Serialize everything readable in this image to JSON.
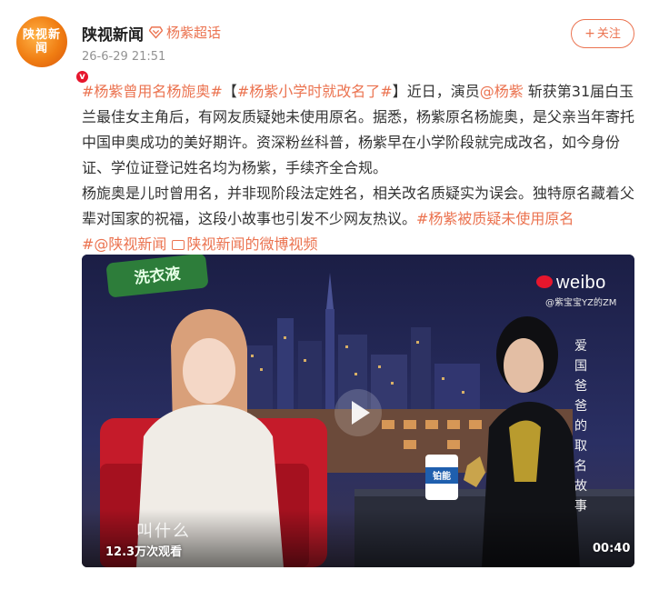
{
  "post": {
    "author": "陕视新闻",
    "avatar_text": "陕视新闻",
    "super_topic": "杨紫超话",
    "time": "26-6-29 21:51",
    "follow_label": "关注",
    "follow_plus": "+"
  },
  "content": {
    "tag1": "#杨紫曾用名杨旎奥#",
    "bracket_open": "【",
    "tag2": "#杨紫小学时就改名了#",
    "bracket_close": "】",
    "t1": "近日，演员",
    "mention": "@杨紫",
    "t2": " 斩获第31届白玉兰最佳女主角后，有网友质疑她未使用原名。据悉，杨紫原名杨旎奥，是父亲当年寄托中国申奥成功的美好期许。资深粉丝科普，杨紫早在小学阶段就完成改名，如今身份证、学位证登记姓名均为杨紫，手续齐全合规。",
    "t3": "杨旎奥是儿时曾用名，并非现阶段法定姓名，相关改名质疑实为误会。独特原名藏着父辈对国家的祝福，这段小故事也引发不少网友热议。",
    "tag3": "#杨紫被质疑未使用原名",
    "tag4": "#",
    "mention2": "@陕视新闻",
    "video_link": "陕视新闻的微博视频"
  },
  "video": {
    "weibo_logo": "weibo",
    "weibo_handle": "@紫宝宝YZ的ZM",
    "vertical_caption": "爱国爸爸的取名故事",
    "subtitle": "叫什么",
    "show_sign": "洗衣液",
    "cup_text": "铂能",
    "views": "12.3万次观看",
    "duration": "00:40"
  },
  "colors": {
    "accent": "#eb7350",
    "verify": "#e6162d"
  }
}
